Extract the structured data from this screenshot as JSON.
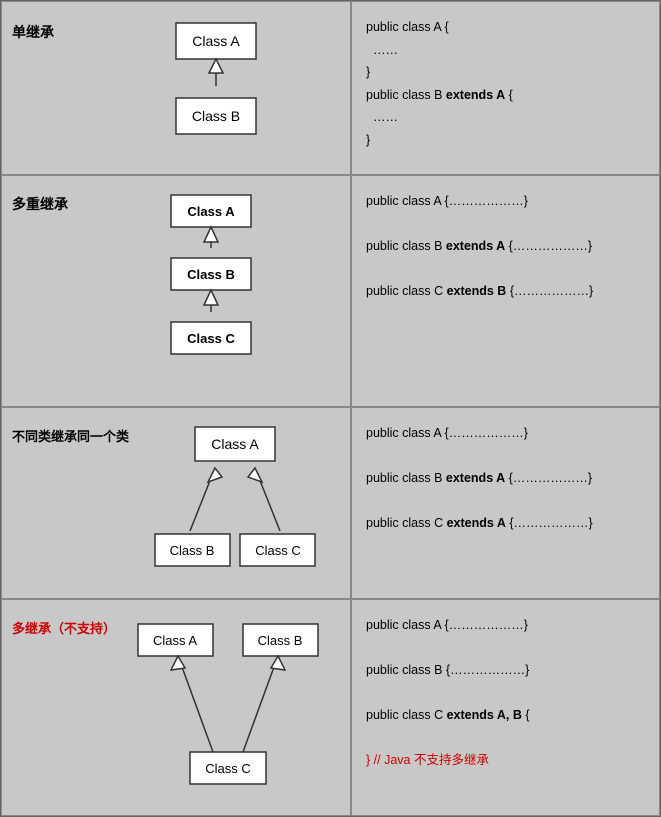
{
  "rows": [
    {
      "label": "单继承",
      "label_color": "#000",
      "diag_type": "single",
      "boxes": [
        "Class A",
        "Class B"
      ],
      "code_lines": [
        {
          "text": "public class A {",
          "bold": false,
          "red": false
        },
        {
          "text": "  ……",
          "bold": false,
          "red": false
        },
        {
          "text": "}",
          "bold": false,
          "red": false
        },
        {
          "text": "public class B ",
          "bold": false,
          "red": false,
          "suffix": "extends A",
          "suffix_bold": true,
          "suffix2": " {",
          "suffix2_bold": false
        },
        {
          "text": "  ……",
          "bold": false,
          "red": false
        },
        {
          "text": "}",
          "bold": false,
          "red": false
        }
      ]
    },
    {
      "label": "多重继承",
      "label_color": "#000",
      "diag_type": "multi_chain",
      "boxes": [
        "Class A",
        "Class B",
        "Class C"
      ],
      "code_lines": [
        {
          "text": "public class A {………………}",
          "bold": false,
          "red": false
        },
        {
          "text": "",
          "bold": false,
          "red": false
        },
        {
          "text": "public class B ",
          "bold": false,
          "red": false,
          "suffix": "extends A",
          "suffix_bold": true,
          "suffix2": " {………………}",
          "suffix2_bold": false
        },
        {
          "text": "",
          "bold": false,
          "red": false
        },
        {
          "text": "public class C ",
          "bold": false,
          "red": false,
          "suffix": "extends B",
          "suffix_bold": true,
          "suffix2": " {………………}",
          "suffix2_bold": false
        }
      ]
    },
    {
      "label": "不同类继承同一个类",
      "label_color": "#000",
      "diag_type": "fan_up",
      "boxes": [
        "Class A",
        "Class B",
        "Class C"
      ],
      "code_lines": [
        {
          "text": "public class A {………………}",
          "bold": false,
          "red": false
        },
        {
          "text": "",
          "bold": false,
          "red": false
        },
        {
          "text": "public class B ",
          "bold": false,
          "red": false,
          "suffix": "extends A",
          "suffix_bold": true,
          "suffix2": " {………………}",
          "suffix2_bold": false
        },
        {
          "text": "",
          "bold": false,
          "red": false
        },
        {
          "text": "public class C ",
          "bold": false,
          "red": false,
          "suffix": "extends A",
          "suffix_bold": true,
          "suffix2": " {………………}",
          "suffix2_bold": false
        }
      ]
    },
    {
      "label": "多继承（不支持）",
      "label_color": "#cc0000",
      "diag_type": "multi_parent",
      "boxes": [
        "Class A",
        "Class B",
        "Class C"
      ],
      "code_lines": [
        {
          "text": "public class A {………………}",
          "bold": false,
          "red": false
        },
        {
          "text": "",
          "bold": false,
          "red": false
        },
        {
          "text": "public class B {………………}",
          "bold": false,
          "red": false
        },
        {
          "text": "",
          "bold": false,
          "red": false
        },
        {
          "text": "public class C ",
          "bold": false,
          "red": false,
          "suffix": "extends A,  B",
          "suffix_bold": true,
          "suffix2": " {",
          "suffix2_bold": false
        },
        {
          "text": "",
          "bold": false,
          "red": false
        },
        {
          "text": "} // Java 不支持多继承",
          "bold": false,
          "red": true
        }
      ]
    }
  ]
}
